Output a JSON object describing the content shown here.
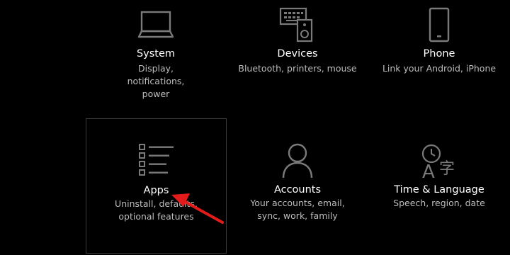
{
  "settings": {
    "tiles": [
      {
        "title": "System",
        "desc": "Display, notifications, power",
        "icon": "laptop-icon"
      },
      {
        "title": "Devices",
        "desc": "Bluetooth, printers, mouse",
        "icon": "devices-icon"
      },
      {
        "title": "Phone",
        "desc": "Link your Android, iPhone",
        "icon": "phone-icon"
      },
      {
        "title": "Apps",
        "desc": "Uninstall, defaults, optional features",
        "icon": "apps-list-icon"
      },
      {
        "title": "Accounts",
        "desc": "Your accounts, email, sync, work, family",
        "icon": "person-icon"
      },
      {
        "title": "Time & Language",
        "desc": "Speech, region, date",
        "icon": "time-language-icon"
      }
    ]
  },
  "colors": {
    "background": "#000000",
    "icon": "#7a7a7a",
    "title": "#ffffff",
    "description": "#bdbdbd",
    "selection_border": "#3b3b3b",
    "annotation_arrow": "#e31b1b"
  }
}
